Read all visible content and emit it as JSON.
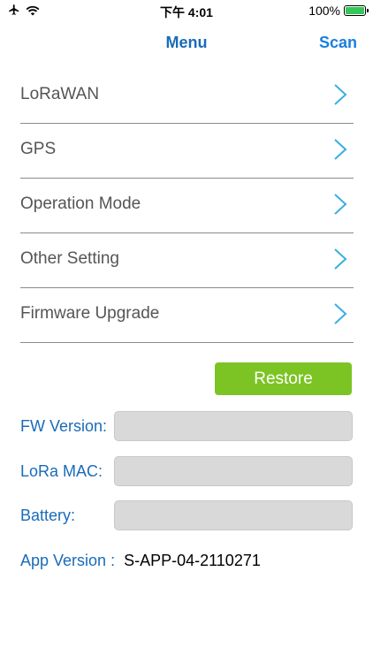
{
  "status_bar": {
    "time": "下午 4:01",
    "battery_percent": "100%",
    "battery_level": 1.0,
    "icons": [
      "airplane-icon",
      "wifi-icon",
      "battery-icon"
    ]
  },
  "nav": {
    "title": "Menu",
    "scan_label": "Scan"
  },
  "menu": {
    "items": [
      {
        "label": "LoRaWAN"
      },
      {
        "label": "GPS"
      },
      {
        "label": "Operation Mode"
      },
      {
        "label": "Other Setting"
      },
      {
        "label": "Firmware Upgrade"
      }
    ]
  },
  "restore_label": "Restore",
  "fields": {
    "fw_version": {
      "label": "FW Version:",
      "value": ""
    },
    "lora_mac": {
      "label": "LoRa MAC:",
      "value": ""
    },
    "battery": {
      "label": "Battery:",
      "value": ""
    }
  },
  "app_version": {
    "label": "App Version :",
    "value": "S-APP-04-2110271"
  },
  "colors": {
    "accent_blue": "#1a6bb8",
    "scan_blue": "#1a7fe0",
    "chevron_blue": "#3aaee0",
    "restore_green": "#7cc424",
    "battery_green": "#34c759",
    "field_gray": "#d9d9d9"
  }
}
